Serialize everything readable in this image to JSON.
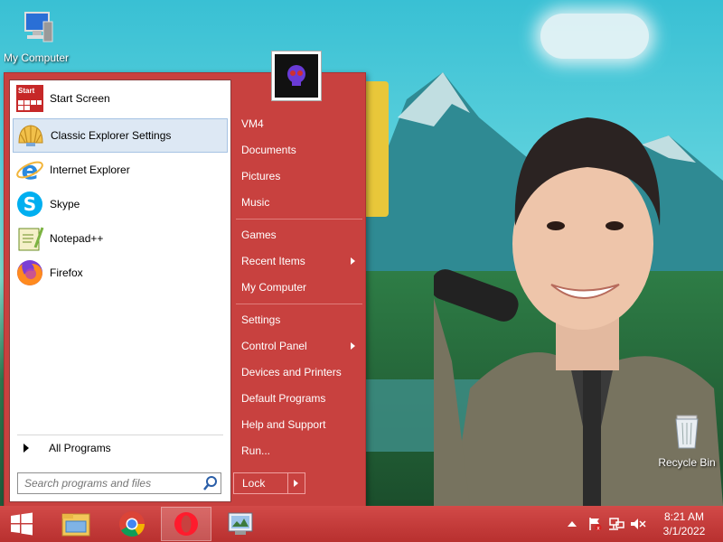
{
  "desktop": {
    "icons": [
      {
        "label": "My Computer"
      },
      {
        "label": "Recycle Bin"
      }
    ]
  },
  "start_menu": {
    "programs": [
      {
        "label": "Start Screen",
        "icon": "start-screen-icon",
        "badge": "Start"
      },
      {
        "label": "Classic Explorer Settings",
        "icon": "shell-icon",
        "highlighted": true
      },
      {
        "label": "Internet Explorer",
        "icon": "internet-explorer-icon"
      },
      {
        "label": "Skype",
        "icon": "skype-icon"
      },
      {
        "label": "Notepad++",
        "icon": "notepadpp-icon"
      },
      {
        "label": "Firefox",
        "icon": "firefox-icon"
      }
    ],
    "all_programs": "All Programs",
    "search_placeholder": "Search programs and files",
    "right_items": [
      {
        "label": "VM4"
      },
      {
        "label": "Documents"
      },
      {
        "label": "Pictures"
      },
      {
        "label": "Music"
      },
      {
        "label": "Games"
      },
      {
        "label": "Recent Items",
        "submenu": true
      },
      {
        "label": "My Computer"
      },
      {
        "label": "Settings"
      },
      {
        "label": "Control Panel",
        "submenu": true
      },
      {
        "label": "Devices and Printers"
      },
      {
        "label": "Default Programs"
      },
      {
        "label": "Help and Support"
      },
      {
        "label": "Run..."
      }
    ],
    "lock_label": "Lock"
  },
  "taskbar": {
    "buttons": [
      "start-windows-icon",
      "file-explorer-icon",
      "chrome-icon",
      "opera-icon",
      "control-panel-icon"
    ],
    "active": "opera-icon",
    "tray": [
      "show-hidden-icons",
      "action-center-flag-icon",
      "network-icon",
      "volume-muted-icon"
    ],
    "clock": {
      "time": "8:21 AM",
      "date": "3/1/2022"
    }
  },
  "colors": {
    "menu_red": "#c8413f",
    "taskbar_red": "#c03a38",
    "highlight": "#dde8f4"
  }
}
